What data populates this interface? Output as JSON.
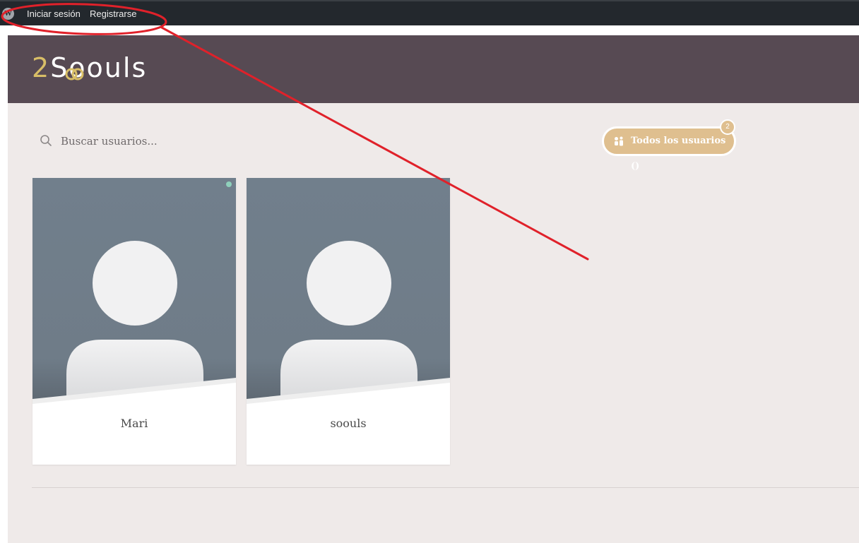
{
  "admin_bar": {
    "logo_icon": "wordpress-icon",
    "links": [
      "Iniciar sesión",
      "Registrarse"
    ]
  },
  "header": {
    "logo_number": "2",
    "logo_text": "Soouls",
    "background_color": "#574a53",
    "accent_color": "#d8be67"
  },
  "search": {
    "icon": "search-icon",
    "placeholder": "Buscar usuarios..."
  },
  "filter": {
    "label": "Todos los usuarios ()",
    "badge": "2",
    "icon": "users-icon",
    "color": "#dfbf8f"
  },
  "members": [
    {
      "name": "Mari",
      "online": true
    },
    {
      "name": "soouls",
      "online": false
    }
  ],
  "colors": {
    "page_background": "#efeae9",
    "admin_bar": "#23282d",
    "annotation": "#e0212a",
    "avatar_background": "#717f8c"
  }
}
